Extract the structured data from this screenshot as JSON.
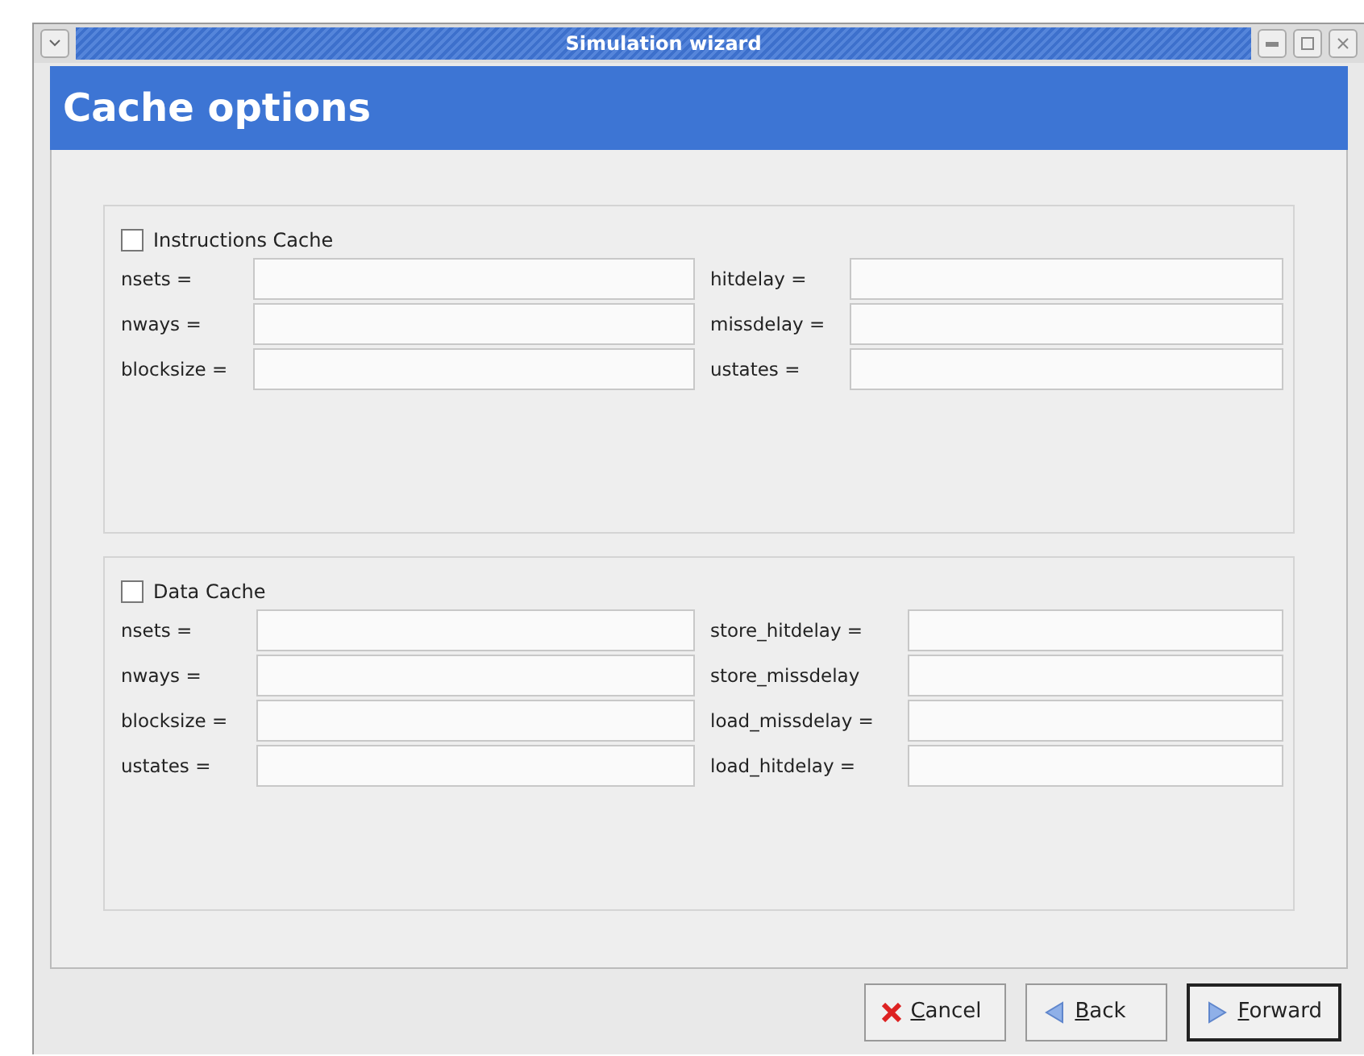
{
  "window": {
    "title": "Simulation wizard"
  },
  "header": {
    "title": "Cache options"
  },
  "sections": [
    {
      "title": "Instructions Cache",
      "checked": false,
      "left": [
        {
          "label": "nsets ="
        },
        {
          "label": "nways ="
        },
        {
          "label": "blocksize ="
        }
      ],
      "right": [
        {
          "label": "hitdelay ="
        },
        {
          "label": "missdelay ="
        },
        {
          "label": "ustates ="
        }
      ]
    },
    {
      "title": "Data Cache",
      "checked": false,
      "left": [
        {
          "label": "nsets ="
        },
        {
          "label": "nways ="
        },
        {
          "label": "blocksize ="
        },
        {
          "label": "ustates ="
        }
      ],
      "right": [
        {
          "label": "store_hitdelay ="
        },
        {
          "label": "store_missdelay"
        },
        {
          "label": "load_missdelay ="
        },
        {
          "label": "load_hitdelay ="
        }
      ]
    }
  ],
  "buttons": [
    {
      "kind": "cancel",
      "label": "Cancel",
      "focused": false
    },
    {
      "kind": "back",
      "label": "Back",
      "focused": false
    },
    {
      "kind": "forward",
      "label": "Forward",
      "focused": true
    }
  ]
}
